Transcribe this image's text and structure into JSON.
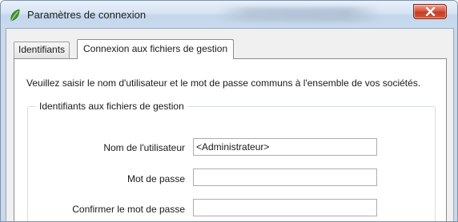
{
  "window": {
    "title": "Paramètres de connexion",
    "close_icon": "close-icon"
  },
  "tabs": [
    {
      "label": "Identifiants",
      "selected": false
    },
    {
      "label": "Connexion aux fichiers de gestion",
      "selected": true
    }
  ],
  "panel": {
    "instruction": "Veuillez saisir le nom d'utilisateur et le mot de passe communs à l'ensemble de vos sociétés.",
    "group": {
      "title": "Identifiants aux fichiers de gestion",
      "fields": {
        "username": {
          "label": "Nom de l'utilisateur",
          "value": "<Administrateur>"
        },
        "password": {
          "label": "Mot de passe",
          "value": ""
        },
        "confirm": {
          "label": "Confirmer le mot de passe",
          "value": ""
        }
      }
    }
  },
  "colors": {
    "titlebar": "#d6e4f3",
    "close_button": "#c43d24",
    "app_icon": "#3f9a2f"
  }
}
